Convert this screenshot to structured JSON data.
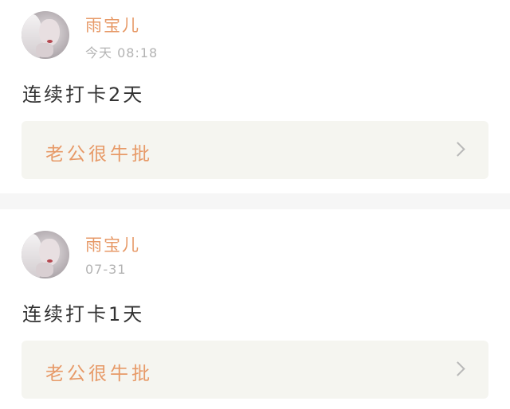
{
  "posts": [
    {
      "username": "雨宝儿",
      "time": "今天 08:18",
      "content": "连续打卡2天",
      "card_label": "老公很牛批"
    },
    {
      "username": "雨宝儿",
      "time": "07-31",
      "content": "连续打卡1天",
      "card_label": "老公很牛批"
    }
  ],
  "icons": {
    "chevron": "chevron-right-icon",
    "avatar": "avatar"
  },
  "colors": {
    "accent": "#e79a68",
    "card_bg": "#f5f5f0",
    "text": "#333333",
    "muted": "#b3b3b3"
  }
}
